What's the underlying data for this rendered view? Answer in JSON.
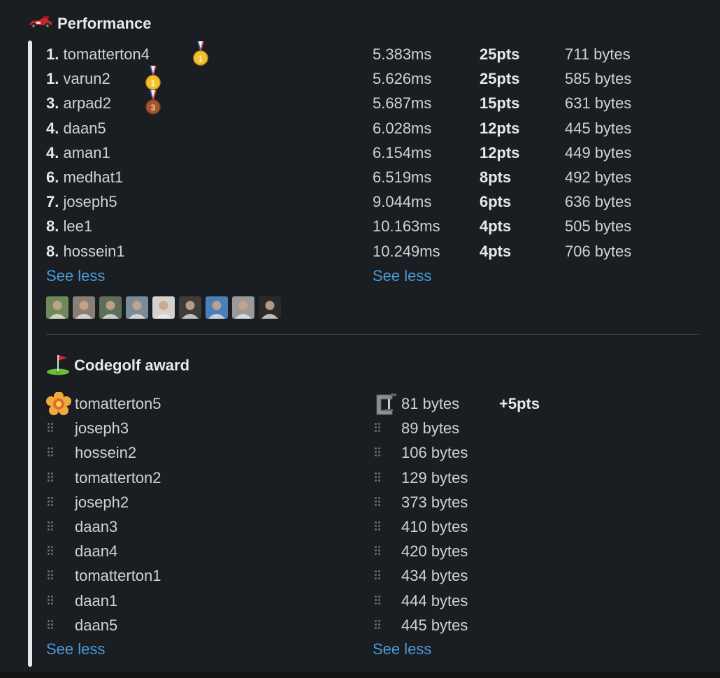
{
  "performance": {
    "title": "Performance",
    "icon": "race-car-icon",
    "rows": [
      {
        "rank": "1.",
        "name": "tomatterton4",
        "medal": "gold",
        "time": "5.383ms",
        "pts": "25pts",
        "bytes": "711 bytes"
      },
      {
        "rank": "1.",
        "name": "varun2",
        "medal": "gold",
        "time": "5.626ms",
        "pts": "25pts",
        "bytes": "585 bytes"
      },
      {
        "rank": "3.",
        "name": "arpad2",
        "medal": "bronze",
        "time": "5.687ms",
        "pts": "15pts",
        "bytes": "631 bytes"
      },
      {
        "rank": "4.",
        "name": "daan5",
        "medal": "",
        "time": "6.028ms",
        "pts": "12pts",
        "bytes": "445 bytes"
      },
      {
        "rank": "4.",
        "name": "aman1",
        "medal": "",
        "time": "6.154ms",
        "pts": "12pts",
        "bytes": "449 bytes"
      },
      {
        "rank": "6.",
        "name": "medhat1",
        "medal": "",
        "time": "6.519ms",
        "pts": "8pts",
        "bytes": "492 bytes"
      },
      {
        "rank": "7.",
        "name": "joseph5",
        "medal": "",
        "time": "9.044ms",
        "pts": "6pts",
        "bytes": "636 bytes"
      },
      {
        "rank": "8.",
        "name": "lee1",
        "medal": "",
        "time": "10.163ms",
        "pts": "4pts",
        "bytes": "505 bytes"
      },
      {
        "rank": "8.",
        "name": "hossein1",
        "medal": "",
        "time": "10.249ms",
        "pts": "4pts",
        "bytes": "706 bytes"
      }
    ],
    "see_less_left": "See less",
    "see_less_right": "See less",
    "avatar_colors": [
      "#6f8a5a",
      "#8a7f75",
      "#5d6f58",
      "#7a8c9a",
      "#d4d1cf",
      "#3c3c3c",
      "#4a7fb8",
      "#9a9a9a",
      "#2a2a2a"
    ]
  },
  "codegolf": {
    "title": "Codegolf award",
    "icon": "golf-flag-icon",
    "winner_icon": "rosette-icon",
    "clamp_icon": "clamp-icon",
    "rows": [
      {
        "name": "tomatterton5",
        "bytes": "81 bytes",
        "pts": "+5pts"
      },
      {
        "name": "joseph3",
        "bytes": "89 bytes",
        "pts": ""
      },
      {
        "name": "hossein2",
        "bytes": "106 bytes",
        "pts": ""
      },
      {
        "name": "tomatterton2",
        "bytes": "129 bytes",
        "pts": ""
      },
      {
        "name": "joseph2",
        "bytes": "373 bytes",
        "pts": ""
      },
      {
        "name": "daan3",
        "bytes": "410 bytes",
        "pts": ""
      },
      {
        "name": "daan4",
        "bytes": "420 bytes",
        "pts": ""
      },
      {
        "name": "tomatterton1",
        "bytes": "434 bytes",
        "pts": ""
      },
      {
        "name": "daan1",
        "bytes": "444 bytes",
        "pts": ""
      },
      {
        "name": "daan5",
        "bytes": "445 bytes",
        "pts": ""
      }
    ],
    "see_less_left": "See less",
    "see_less_right": "See less"
  }
}
